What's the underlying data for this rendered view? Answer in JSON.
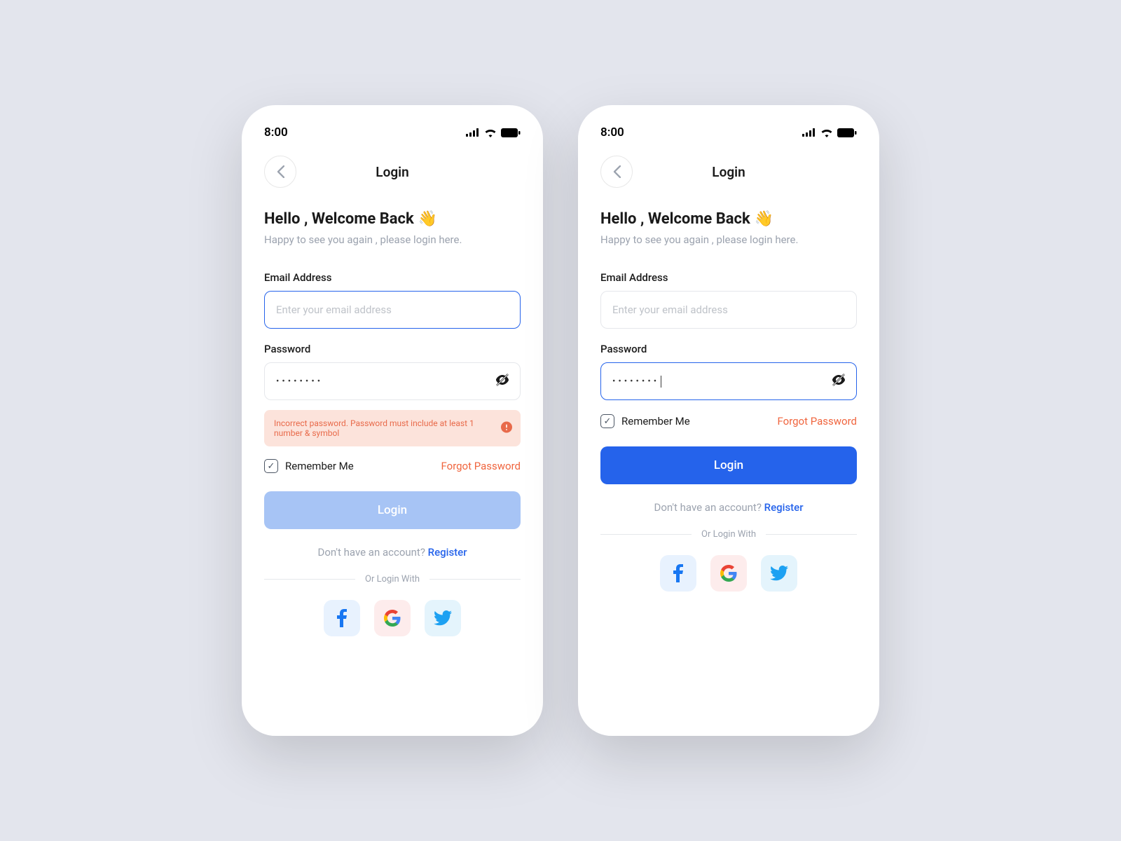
{
  "statusbar": {
    "time": "8:00"
  },
  "nav": {
    "title": "Login"
  },
  "heading": "Hello , Welcome Back",
  "heading_emoji": "👋",
  "subheading": "Happy to see you again , please login here.",
  "fields": {
    "email": {
      "label": "Email Address",
      "placeholder": "Enter your email address"
    },
    "password": {
      "label": "Password",
      "masked": "••••••••"
    }
  },
  "error": "Incorrect password. Password must include at least 1 number & symbol",
  "remember": "Remember Me",
  "forgot": "Forgot Password",
  "login_btn": "Login",
  "signup_prompt": "Don't have an account? ",
  "signup_link": "Register",
  "divider": "Or Login With"
}
